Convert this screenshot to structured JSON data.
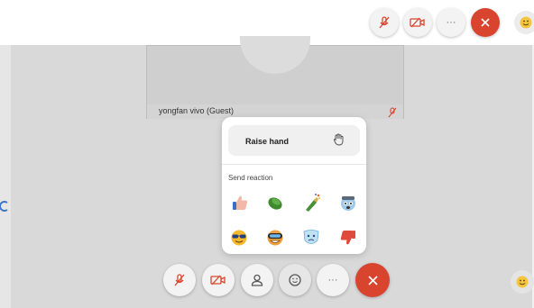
{
  "tile": {
    "participant_name": "yongfan vivo (Guest)"
  },
  "popup": {
    "raise_hand_label": "Raise hand",
    "send_reaction_label": "Send reaction",
    "reactions": [
      "thumbs-up",
      "clap",
      "celebrate",
      "surprised",
      "cool",
      "laugh",
      "sad",
      "thumbs-down"
    ]
  },
  "top_toolbar": {
    "more_label": "···"
  },
  "bottom_toolbar": {
    "more_label": "···"
  },
  "colors": {
    "end_call": "#d9442f",
    "muted_icon": "#d9442f",
    "background": "#d9d9d9"
  }
}
